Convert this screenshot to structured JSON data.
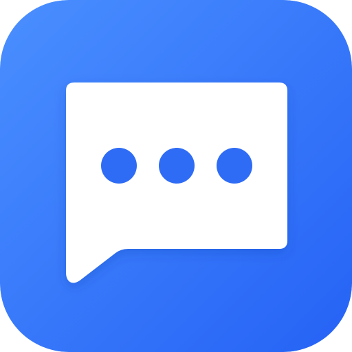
{
  "icon": {
    "name": "chat-bubble-icon",
    "depicts": "speech-bubble-with-three-dots",
    "colors": {
      "background_top_left": "#4a8fff",
      "background_bottom_right": "#2562f5",
      "bubble": "#ffffff",
      "dots": "#2f6cf5"
    },
    "dot_count": 3
  }
}
